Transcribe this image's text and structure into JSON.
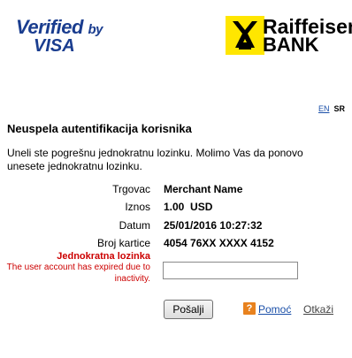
{
  "logos": {
    "visa_verified": "Verified",
    "visa_by": "by",
    "visa_visa": "VISA",
    "bank_name_line1": "Raiffeisen",
    "bank_name_line2": "BANK",
    "bank_brand_color": "#ffe600"
  },
  "language": {
    "en": "EN",
    "sr": "SR"
  },
  "title": "Neuspela autentifikacija korisnika",
  "message": "Uneli ste pogrešnu jednokratnu lozinku. Molimo Vas da ponovo unesete jednokratnu lozinku.",
  "details": [
    {
      "label": "Trgovac",
      "value": "Merchant Name"
    },
    {
      "label": "Iznos",
      "value": "1.00  USD"
    },
    {
      "label": "Datum",
      "value": "25/01/2016 10:27:32"
    },
    {
      "label": "Broj kartice",
      "value": "4054 76XX XXXX 4152"
    }
  ],
  "otp": {
    "label": "Jednokratna lozinka",
    "error": "The user account has expired due to inactivity.",
    "value": "",
    "error_color": "#cc0000"
  },
  "buttons": {
    "send": "Pošalji",
    "help_icon_glyph": "?",
    "help": "Pomoć",
    "cancel": "Otkaži"
  }
}
